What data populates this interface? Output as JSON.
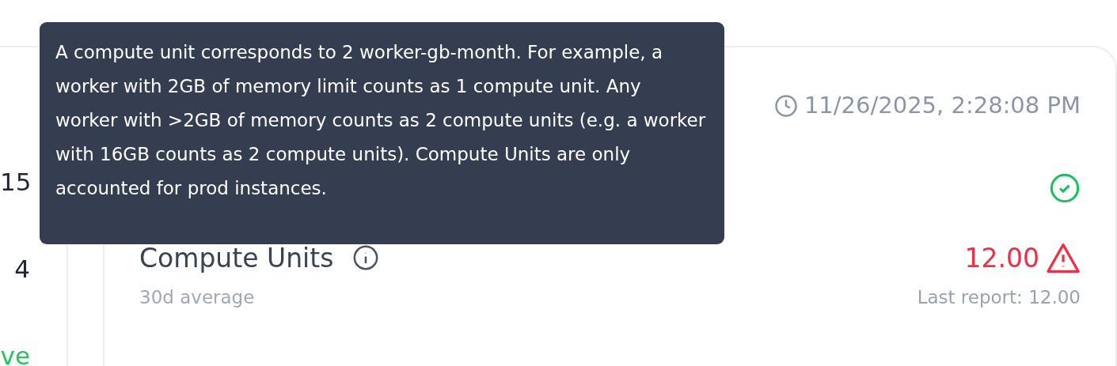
{
  "left_panel": {
    "rows": [
      {
        "value": "15",
        "kind": "number"
      },
      {
        "value": "4",
        "kind": "number"
      },
      {
        "value": "ve",
        "kind": "status"
      }
    ]
  },
  "card": {
    "timestamp": "11/26/2025, 2:28:08 PM",
    "healthy": true,
    "metric": {
      "label": "Compute Units",
      "sublabel": "30d average",
      "value": "12.00",
      "warning": true,
      "last_report": "Last report: 12.00"
    }
  },
  "tooltip": {
    "text": "A compute unit corresponds to 2 worker-gb-month. For example, a worker with 2GB of memory limit counts as 1 compute unit. Any worker with >2GB of memory counts as 2 compute units (e.g. a worker with 16GB counts as 2 compute units). Compute Units are only accounted for prod instances."
  }
}
